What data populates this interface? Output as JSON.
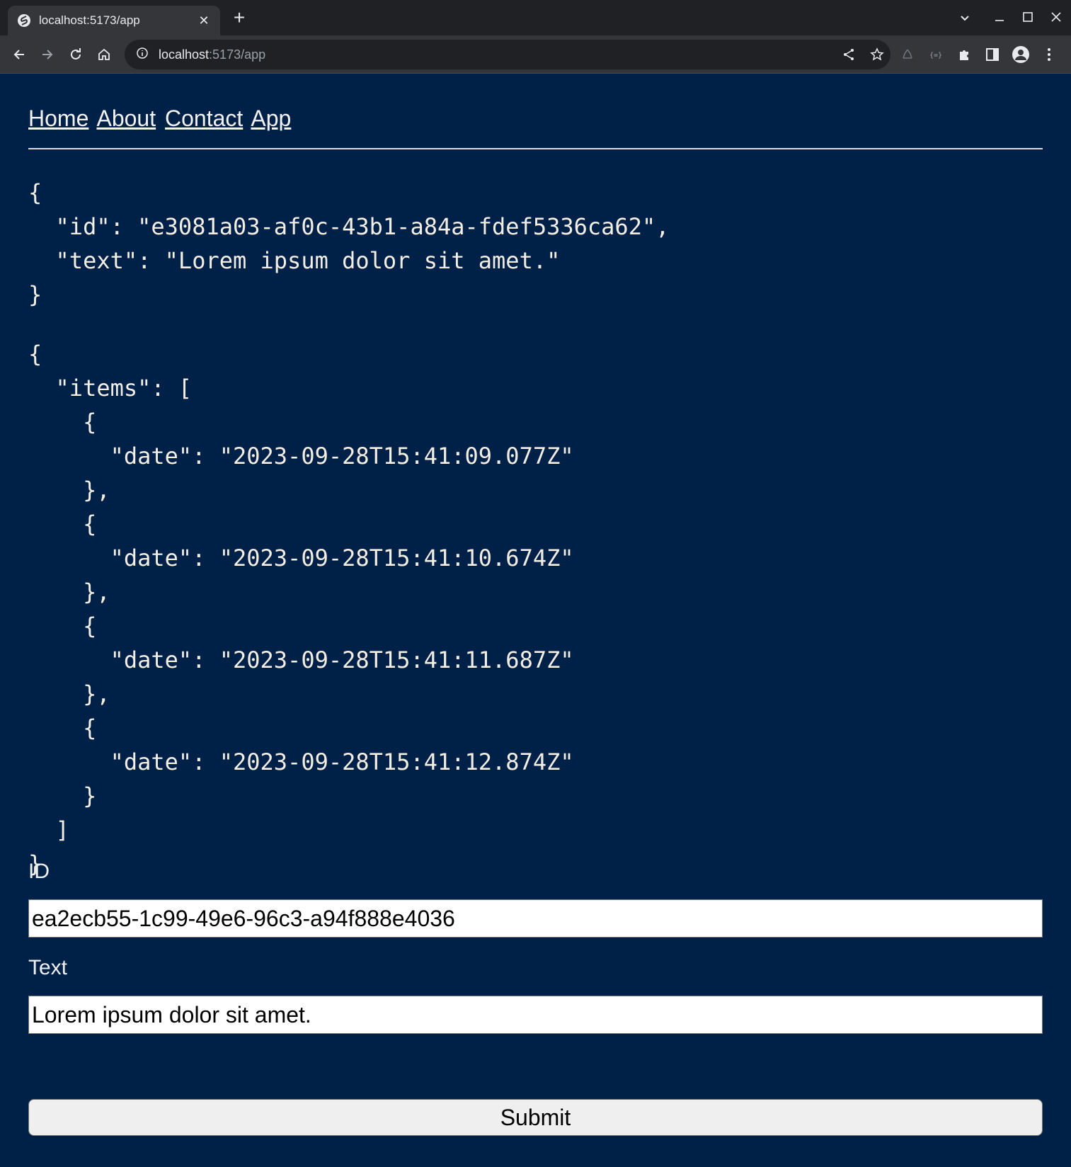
{
  "browser": {
    "tab_title": "localhost:5173/app",
    "url_host": "localhost",
    "url_path": ":5173/app"
  },
  "nav": {
    "links": [
      "Home",
      "About",
      "Contact",
      "App"
    ]
  },
  "content": {
    "json_block_1": "{\n  \"id\": \"e3081a03-af0c-43b1-a84a-fdef5336ca62\",\n  \"text\": \"Lorem ipsum dolor sit amet.\"\n}",
    "json_block_2": "{\n  \"items\": [\n    {\n      \"date\": \"2023-09-28T15:41:09.077Z\"\n    },\n    {\n      \"date\": \"2023-09-28T15:41:10.674Z\"\n    },\n    {\n      \"date\": \"2023-09-28T15:41:11.687Z\"\n    },\n    {\n      \"date\": \"2023-09-28T15:41:12.874Z\"\n    }\n  ]\n}"
  },
  "form": {
    "id_label": "ID",
    "id_value": "ea2ecb55-1c99-49e6-96c3-a94f888e4036",
    "text_label": "Text",
    "text_value": "Lorem ipsum dolor sit amet.",
    "submit_label": "Submit"
  },
  "colors": {
    "page_background": "#002147",
    "chrome_dark": "#202124",
    "chrome_toolbar": "#35363a"
  }
}
